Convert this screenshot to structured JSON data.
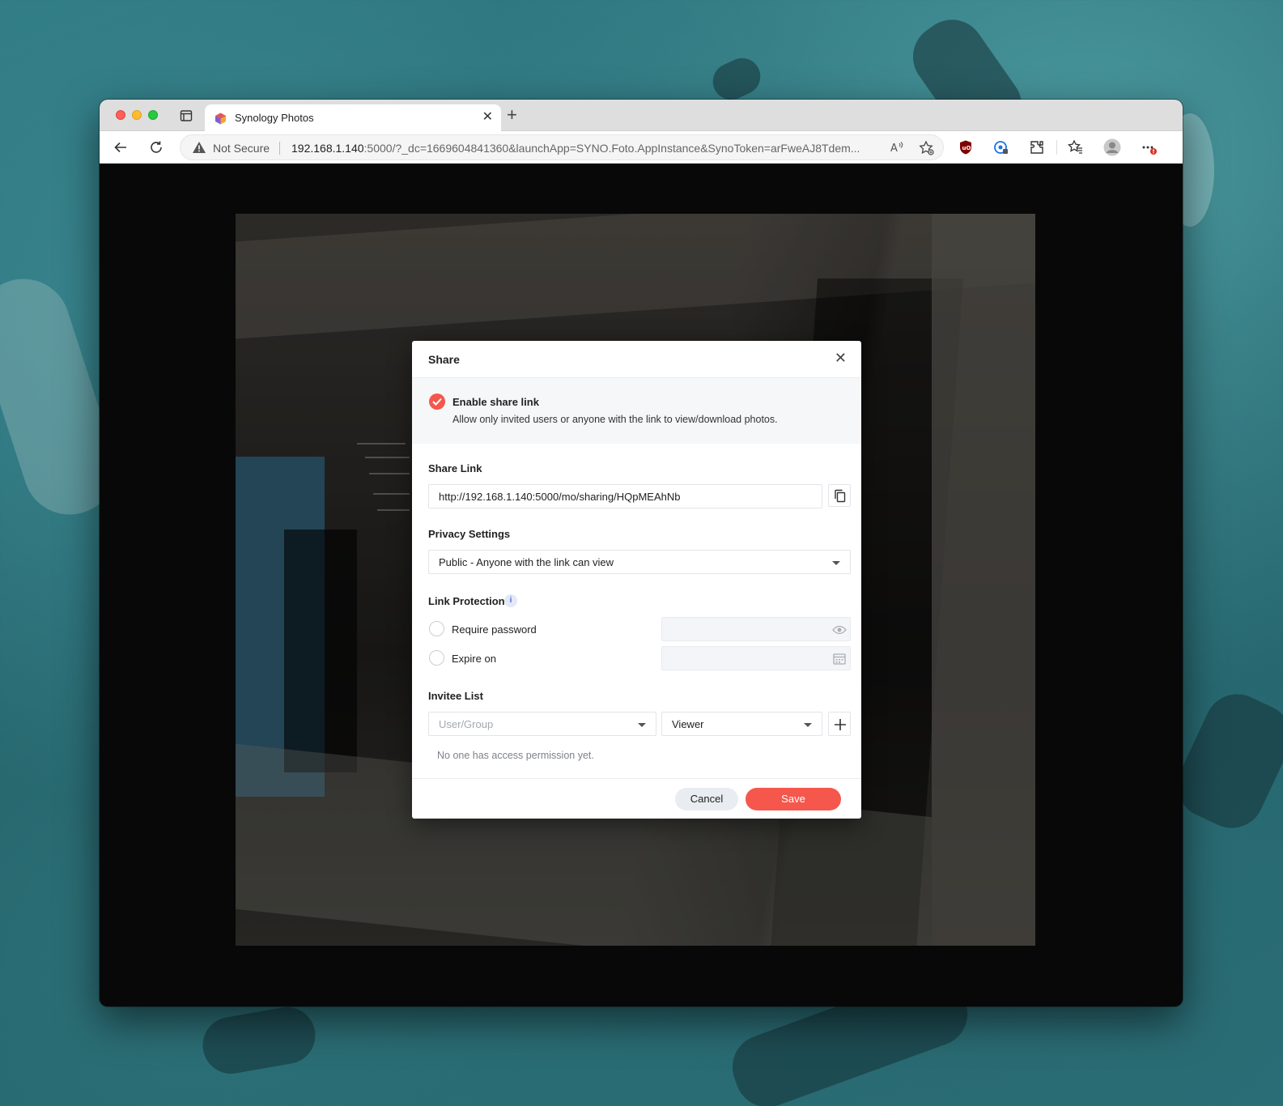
{
  "browser": {
    "tab_title": "Synology Photos",
    "security_label": "Not Secure",
    "url_host": "192.168.1.140",
    "url_rest": ":5000/?_dc=1669604841360&launchApp=SYNO.Foto.AppInstance&SynoToken=arFweAJ8Tdem..."
  },
  "dialog": {
    "title": "Share",
    "enable": {
      "title": "Enable share link",
      "description": "Allow only invited users or anyone with the link to view/download photos."
    },
    "share_link": {
      "label": "Share Link",
      "value": "http://192.168.1.140:5000/mo/sharing/HQpMEAhNb"
    },
    "privacy": {
      "label": "Privacy Settings",
      "value": "Public - Anyone with the link can view"
    },
    "link_protection": {
      "label": "Link Protection",
      "info": "i",
      "require_password": "Require password",
      "expire_on": "Expire on"
    },
    "invitee": {
      "label": "Invitee List",
      "user_placeholder": "User/Group",
      "role_value": "Viewer",
      "empty_message": "No one has access permission yet."
    },
    "buttons": {
      "cancel": "Cancel",
      "save": "Save"
    }
  },
  "colors": {
    "accent": "#f5574c",
    "info": "#4a6fd8"
  }
}
